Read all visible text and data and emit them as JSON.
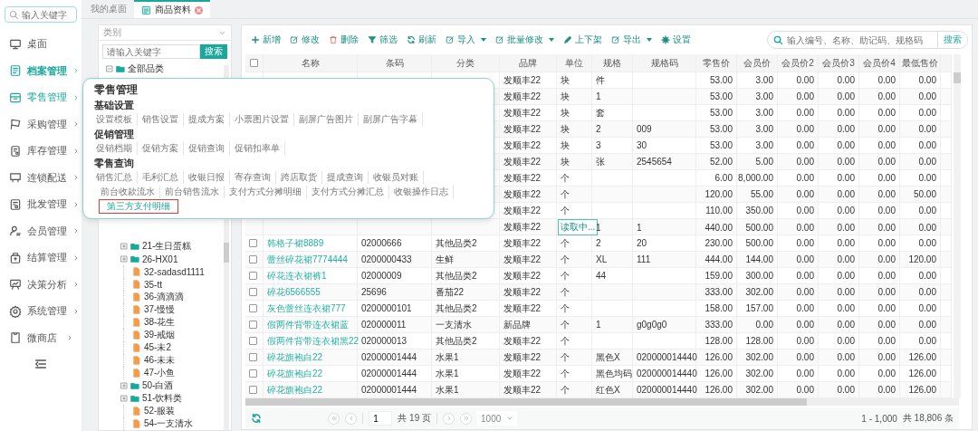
{
  "nav": {
    "search": {
      "placeholder": "输入关键字"
    },
    "items": [
      {
        "label": "桌面",
        "selected": false,
        "open": false,
        "expandable": false
      },
      {
        "label": "档案管理",
        "selected": true,
        "open": false,
        "expandable": true
      },
      {
        "label": "零售管理",
        "selected": false,
        "open": true,
        "expandable": true
      },
      {
        "label": "采购管理",
        "selected": false,
        "open": false,
        "expandable": true
      },
      {
        "label": "库存管理",
        "selected": false,
        "open": false,
        "expandable": true
      },
      {
        "label": "连锁配送",
        "selected": false,
        "open": false,
        "expandable": true
      },
      {
        "label": "批发管理",
        "selected": false,
        "open": false,
        "expandable": true
      },
      {
        "label": "会员管理",
        "selected": false,
        "open": false,
        "expandable": true
      },
      {
        "label": "结算管理",
        "selected": false,
        "open": false,
        "expandable": true
      },
      {
        "label": "决策分析",
        "selected": false,
        "open": false,
        "expandable": true
      },
      {
        "label": "系统管理",
        "selected": false,
        "open": false,
        "expandable": true
      },
      {
        "label": "微商店",
        "selected": false,
        "open": false,
        "expandable": true
      }
    ]
  },
  "tabs": [
    {
      "label": "我的桌面",
      "selected": false,
      "closable": false
    },
    {
      "label": "商品资料",
      "selected": true,
      "closable": true
    }
  ],
  "category_panel": {
    "select": {
      "value": "类别"
    },
    "search": {
      "placeholder": "请输入关键字",
      "button": "搜索"
    },
    "tree": [
      {
        "label": "全部品类",
        "kind": "folder",
        "expanded": true,
        "children": [
          {
            "label": "21-生日蛋糕",
            "kind": "folder",
            "expanded": false
          },
          {
            "label": "26-HX01",
            "kind": "folder",
            "expanded": false
          },
          {
            "label": "32-sadasd1111",
            "kind": "leaf"
          },
          {
            "label": "35-tt",
            "kind": "leaf"
          },
          {
            "label": "36-滴滴滴",
            "kind": "leaf"
          },
          {
            "label": "37-慢慢",
            "kind": "leaf"
          },
          {
            "label": "38-花生",
            "kind": "leaf"
          },
          {
            "label": "39-戒烟",
            "kind": "leaf"
          },
          {
            "label": "45-未2",
            "kind": "leaf"
          },
          {
            "label": "46-未未",
            "kind": "leaf"
          },
          {
            "label": "47-小鱼",
            "kind": "leaf"
          },
          {
            "label": "50-白酒",
            "kind": "folder",
            "expanded": false
          },
          {
            "label": "51-饮料类",
            "kind": "folder",
            "expanded": false
          },
          {
            "label": "52-服装",
            "kind": "leaf"
          },
          {
            "label": "54-一支清水",
            "kind": "leaf"
          }
        ]
      }
    ]
  },
  "toolbar": {
    "buttons": [
      {
        "label": "新增",
        "dropdown": false
      },
      {
        "label": "修改",
        "dropdown": false
      },
      {
        "label": "删除",
        "dropdown": false
      },
      {
        "label": "筛选",
        "dropdown": false
      },
      {
        "label": "刷新",
        "dropdown": false
      },
      {
        "label": "导入",
        "dropdown": true
      },
      {
        "label": "批量修改",
        "dropdown": true
      },
      {
        "label": "上下架",
        "dropdown": false
      },
      {
        "label": "导出",
        "dropdown": true
      },
      {
        "label": "设置",
        "dropdown": false
      }
    ],
    "search": {
      "placeholder": "输入编号、名称、助记码、规格码",
      "button": "搜索"
    }
  },
  "table": {
    "select_all": {
      "checked": false
    },
    "columns": [
      "名称",
      "条码",
      "分类",
      "品牌",
      "单位",
      "规格",
      "规格码",
      "零售价",
      "会员价",
      "会员价2",
      "会员价3",
      "会员价4",
      "最低售价"
    ],
    "rows": [
      {
        "editing": false,
        "brand": "发顺丰22",
        "unit": "块",
        "spec": "件",
        "retail_price": "53.00",
        "member_price": "3.00",
        "member_price_2": "0.00",
        "member_price_3": "0.00",
        "member_price_4": "0.00",
        "min_price": "0.00"
      },
      {
        "editing": false,
        "brand": "发顺丰22",
        "unit": "块",
        "spec": "1",
        "retail_price": "53.00",
        "member_price": "3.00",
        "member_price_2": "0.00",
        "member_price_3": "0.00",
        "member_price_4": "0.00",
        "min_price": "0.00"
      },
      {
        "editing": false,
        "brand": "发顺丰22",
        "unit": "块",
        "spec": "套",
        "retail_price": "53.00",
        "member_price": "3.00",
        "member_price_2": "0.00",
        "member_price_3": "0.00",
        "member_price_4": "0.00",
        "min_price": "0.00"
      },
      {
        "editing": false,
        "brand": "发顺丰22",
        "unit": "块",
        "spec": "2",
        "spec_code": "009",
        "retail_price": "53.00",
        "member_price": "3.00",
        "member_price_2": "0.00",
        "member_price_3": "0.00",
        "member_price_4": "0.00",
        "min_price": "0.00"
      },
      {
        "editing": false,
        "brand": "发顺丰22",
        "unit": "块",
        "spec": "3",
        "spec_code": "30",
        "retail_price": "53.00",
        "member_price": "3.00",
        "member_price_2": "0.00",
        "member_price_3": "0.00",
        "member_price_4": "0.00",
        "min_price": "0.00"
      },
      {
        "editing": false,
        "brand": "发顺丰22",
        "unit": "块",
        "spec": "张",
        "spec_code": "2545654",
        "retail_price": "52.00",
        "member_price": "5.00",
        "member_price_2": "0.00",
        "member_price_3": "0.00",
        "member_price_4": "0.00",
        "min_price": "0.00"
      },
      {
        "editing": false,
        "brand": "发顺丰22",
        "unit": "个",
        "retail_price": "6.00",
        "member_price": "8,000.00",
        "member_price_2": "0.00",
        "member_price_3": "0.00",
        "member_price_4": "0.00",
        "min_price": "0.00"
      },
      {
        "editing": false,
        "brand": "发顺丰22",
        "unit": "个",
        "retail_price": "120.00",
        "member_price": "55.00",
        "member_price_2": "0.00",
        "member_price_3": "0.00",
        "member_price_4": "0.00",
        "min_price": "50.00"
      },
      {
        "editing": false,
        "brand": "发顺丰22",
        "unit": "个",
        "retail_price": "110.00",
        "member_price": "350.00",
        "member_price_2": "0.00",
        "member_price_3": "0.00",
        "member_price_4": "0.00",
        "min_price": "0.00"
      },
      {
        "editing": true,
        "brand": "发顺丰22",
        "unit": "读取中...",
        "spec": "1",
        "spec_code": "1",
        "retail_price": "440.00",
        "member_price": "500.00",
        "member_price_2": "0.00",
        "member_price_3": "0.00",
        "member_price_4": "0.00",
        "min_price": "0.00"
      },
      {
        "checked": false,
        "editing": false,
        "name": "韩格子裙8889",
        "barcode": "02000666",
        "category": "其他品类2",
        "brand": "发顺丰22",
        "unit": "个",
        "spec": "2",
        "spec_code": "20",
        "retail_price": "230.00",
        "member_price": "500.00",
        "member_price_2": "0.00",
        "member_price_3": "0.00",
        "member_price_4": "0.00",
        "min_price": "0.00"
      },
      {
        "checked": false,
        "editing": false,
        "name": "蕾丝碎花裙7774444",
        "barcode": "0200000433",
        "category": "生鲜",
        "brand": "发顺丰22",
        "unit": "个",
        "spec": "XL",
        "spec_code": "111",
        "retail_price": "444.00",
        "member_price": "144.00",
        "member_price_2": "0.00",
        "member_price_3": "0.00",
        "member_price_4": "0.00",
        "min_price": "120.00"
      },
      {
        "checked": false,
        "editing": false,
        "name": "碎花连衣裙裤1",
        "barcode": "02000009",
        "category": "其他品类2",
        "brand": "发顺丰22",
        "unit": "个",
        "spec": "44",
        "retail_price": "159.00",
        "member_price": "300.00",
        "member_price_2": "0.00",
        "member_price_3": "0.00",
        "member_price_4": "0.00",
        "min_price": "0.00"
      },
      {
        "checked": false,
        "editing": false,
        "name": "碎花6566555",
        "barcode": "25696",
        "category": "番茄22",
        "brand": "发顺丰22",
        "unit": "个",
        "retail_price": "333.00",
        "member_price": "302.00",
        "member_price_2": "0.00",
        "member_price_3": "0.00",
        "member_price_4": "0.00",
        "min_price": "0.00"
      },
      {
        "checked": false,
        "editing": false,
        "name": "灰色蕾丝连衣裙777",
        "barcode": "0200000101",
        "category": "其他品类2",
        "brand": "发顺丰22",
        "unit": "个",
        "retail_price": "158.00",
        "member_price": "157.00",
        "member_price_2": "0.00",
        "member_price_3": "0.00",
        "member_price_4": "0.00",
        "min_price": "0.00"
      },
      {
        "checked": false,
        "editing": false,
        "name": "假两件背带连衣裙蓝",
        "barcode": "020000011",
        "category": "一支清水",
        "brand": "新品牌",
        "unit": "个",
        "spec": "1",
        "spec_code": "g0g0g0",
        "retail_price": "333.00",
        "member_price": "0.00",
        "member_price_2": "0.00",
        "member_price_3": "0.00",
        "member_price_4": "0.00",
        "min_price": "0.00"
      },
      {
        "checked": false,
        "editing": false,
        "name": "假两件背带连衣裙黑22",
        "barcode": "020000013",
        "category": "其他品类2",
        "brand": "发顺丰22",
        "unit": "个",
        "retail_price": "128.00",
        "member_price": "128.00",
        "member_price_2": "0.00",
        "member_price_3": "0.00",
        "member_price_4": "0.00",
        "min_price": "0.00"
      },
      {
        "checked": false,
        "editing": false,
        "name": "碎花旗袍白22",
        "barcode": "02000001444",
        "category": "水果1",
        "brand": "发顺丰22",
        "unit": "个",
        "spec": "黑色X",
        "spec_code": "020000014440",
        "retail_price": "126.00",
        "member_price": "302.00",
        "member_price_2": "0.00",
        "member_price_3": "0.00",
        "member_price_4": "0.00",
        "min_price": "126.00"
      },
      {
        "checked": false,
        "editing": false,
        "name": "碎花旗袍白22",
        "barcode": "02000001444",
        "category": "水果1",
        "brand": "发顺丰22",
        "unit": "个",
        "spec": "黑色均码",
        "spec_code": "020000014440",
        "retail_price": "126.00",
        "member_price": "302.00",
        "member_price_2": "0.00",
        "member_price_3": "0.00",
        "member_price_4": "0.00",
        "min_price": "126.00"
      },
      {
        "checked": false,
        "editing": false,
        "name": "碎花旗袍白22",
        "barcode": "02000001444",
        "category": "水果1",
        "brand": "发顺丰22",
        "unit": "个",
        "spec": "红色X",
        "spec_code": "020000014440",
        "retail_price": "126.00",
        "member_price": "302.00",
        "member_price_2": "0.00",
        "member_price_3": "0.00",
        "member_price_4": "0.00",
        "min_price": "126.00"
      }
    ]
  },
  "pagination": {
    "page": "1",
    "page_count": "共 19 页",
    "page_size": "1000",
    "range": "1 - 1,000",
    "total": "共 18,806 条"
  },
  "popup": {
    "title": "零售管理",
    "sections": [
      {
        "heading": "基础设置",
        "links": [
          {
            "label": "设置模板",
            "selected": false
          },
          {
            "label": "销售设置",
            "selected": false
          },
          {
            "label": "提成方案",
            "selected": false
          },
          {
            "label": "小票图片设置",
            "selected": false
          },
          {
            "label": "副屏广告图片",
            "selected": false
          },
          {
            "label": "副屏广告字幕",
            "selected": false
          }
        ]
      },
      {
        "heading": "促销管理",
        "links": [
          {
            "label": "促销档期",
            "selected": false
          },
          {
            "label": "促销方案",
            "selected": false
          },
          {
            "label": "促销查询",
            "selected": false
          },
          {
            "label": "促销扣率单",
            "selected": false
          }
        ]
      },
      {
        "heading": "零售查询",
        "links": [
          {
            "label": "销售汇总",
            "selected": false
          },
          {
            "label": "毛利汇总",
            "selected": false
          },
          {
            "label": "收银日报",
            "selected": false
          },
          {
            "label": "寄存查询",
            "selected": false
          },
          {
            "label": "跨店取货",
            "selected": false
          },
          {
            "label": "提成查询",
            "selected": false
          },
          {
            "label": "收银员对账",
            "selected": false
          },
          {
            "label": "前台收款流水",
            "selected": false
          },
          {
            "label": "前台销售流水",
            "selected": false
          },
          {
            "label": "支付方式分摊明细",
            "selected": false
          },
          {
            "label": "支付方式分摊汇总",
            "selected": false
          },
          {
            "label": "收银操作日志",
            "selected": false
          },
          {
            "label": "第三方支付明细",
            "selected": true
          }
        ]
      }
    ]
  }
}
